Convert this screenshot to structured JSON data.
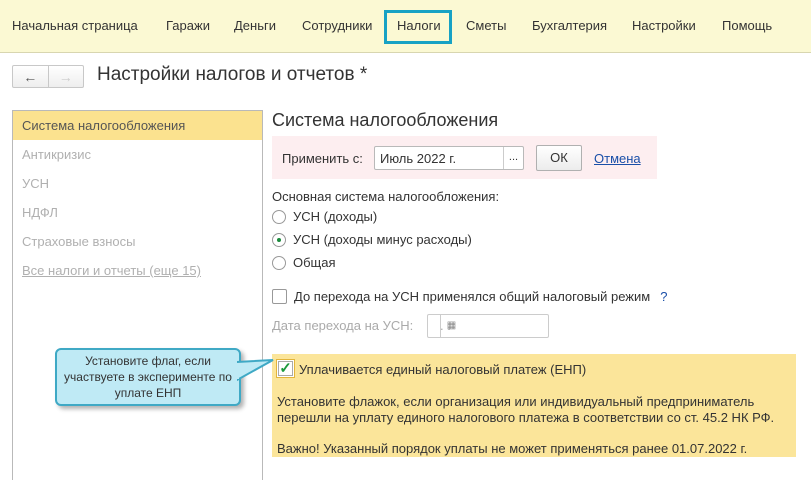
{
  "topnav": {
    "items": [
      "Начальная страница",
      "Гаражи",
      "Деньги",
      "Сотрудники",
      "Налоги",
      "Сметы",
      "Бухгалтерия",
      "Настройки",
      "Помощь"
    ],
    "active": "Налоги"
  },
  "header": {
    "title": "Настройки налогов и отчетов *"
  },
  "sidebar": {
    "items": [
      "Система налогообложения",
      "Антикризис",
      "УСН",
      "НДФЛ",
      "Страховые взносы",
      "Все налоги и отчеты (еще 15)"
    ]
  },
  "main": {
    "heading": "Система налогообложения",
    "apply": {
      "label": "Применить с:",
      "value": "Июль 2022 г.",
      "dots": "...",
      "ok": "ОК",
      "cancel": "Отмена"
    },
    "system_label": "Основная система налогообложения:",
    "radios": [
      "УСН (доходы)",
      "УСН (доходы минус расходы)",
      "Общая"
    ],
    "radio_selected": "УСН (доходы минус расходы)",
    "prior_general": {
      "label": "До перехода на УСН применялся общий налоговый режим",
      "help": "?",
      "checked": false
    },
    "transition_date": {
      "label": "Дата перехода на УСН:",
      "value": " .  ."
    },
    "enp": {
      "label": "Уплачивается единый налоговый платеж (ЕНП)",
      "checked": true,
      "mark": "✓",
      "description": "Установите флажок, если организация или индивидуальный предприниматель перешли на уплату единого налогового платежа в соответствии со ст. 45.2 НК РФ.",
      "important": "Важно! Указанный порядок уплаты не может применяться ранее 01.07.2022 г."
    }
  },
  "callout": {
    "text": "Установите флаг, если участвуете в эксперименте по уплате ЕНП"
  }
}
